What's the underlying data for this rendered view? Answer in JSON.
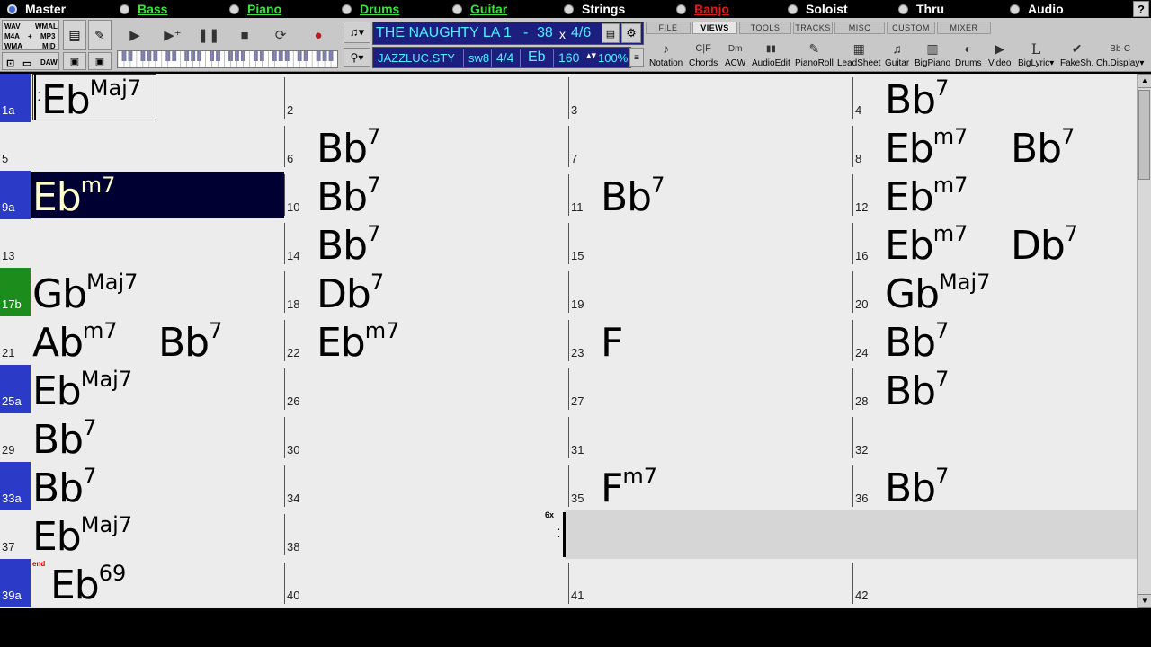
{
  "tracks": [
    {
      "label": "Master",
      "style": "white",
      "dot": "master"
    },
    {
      "label": "Bass",
      "style": "green"
    },
    {
      "label": "Piano",
      "style": "green"
    },
    {
      "label": "Drums",
      "style": "green"
    },
    {
      "label": "Guitar",
      "style": "green"
    },
    {
      "label": "Strings",
      "style": "white"
    },
    {
      "label": "Banjo",
      "style": "red"
    },
    {
      "label": "Soloist",
      "style": "white"
    },
    {
      "label": "Thru",
      "style": "white"
    },
    {
      "label": "Audio",
      "style": "white"
    }
  ],
  "help_label": "?",
  "formats": {
    "wav": "WAV",
    "wmal": "WMAL",
    "m4a": "M4A",
    "plus": "+",
    "mp3": "MP3",
    "wma": "WMA",
    "mid": "MID",
    "daw": "DAW"
  },
  "song": {
    "title": "THE NAUGHTY LA",
    "bar_from": "1",
    "dash": "-",
    "bar_to": "38",
    "times": "x",
    "choruses": "4/6",
    "style": "JAZZLUC.STY",
    "feel": "sw8",
    "time_sig": "4/4",
    "key": "Eb",
    "tempo": "160",
    "tempo_pct": "100%"
  },
  "view_tabs": [
    "FILE",
    "VIEWS",
    "TOOLS",
    "TRACKS",
    "MISC",
    "CUSTOM",
    "MIXER"
  ],
  "active_tab": "VIEWS",
  "view_items": [
    {
      "label": "Notation",
      "icon": "♪"
    },
    {
      "label": "Chords",
      "icon": "C|F"
    },
    {
      "label": "ACW",
      "icon": "Dm"
    },
    {
      "label": "AudioEdit",
      "icon": "▮▮"
    },
    {
      "label": "PianoRoll",
      "icon": "✎"
    },
    {
      "label": "LeadSheet",
      "icon": "▦"
    },
    {
      "label": "Guitar",
      "icon": "♫"
    },
    {
      "label": "BigPiano",
      "icon": "▥"
    },
    {
      "label": "Drums",
      "icon": "◐"
    },
    {
      "label": "Video",
      "icon": "▶"
    },
    {
      "label": "BigLyric▾",
      "icon": "L"
    },
    {
      "label": "FakeSh.",
      "icon": "✔"
    },
    {
      "label": "Ch.Display▾",
      "icon": "Bb·C"
    }
  ],
  "bars": [
    {
      "n": "1a",
      "marker": "blue",
      "chords": [
        {
          "r": "Eb",
          "e": "Maj7"
        }
      ],
      "repeat_start": true,
      "current": true
    },
    {
      "n": "2",
      "chords": []
    },
    {
      "n": "3",
      "chords": []
    },
    {
      "n": "4",
      "chords": [
        {
          "r": "Bb",
          "e": "7"
        }
      ]
    },
    {
      "n": "5",
      "chords": []
    },
    {
      "n": "6",
      "chords": [
        {
          "r": "Bb",
          "e": "7"
        }
      ]
    },
    {
      "n": "7",
      "chords": []
    },
    {
      "n": "8",
      "chords": [
        {
          "r": "Eb",
          "e": "m7"
        },
        {
          "r": "Bb",
          "e": "7"
        }
      ]
    },
    {
      "n": "9a",
      "marker": "blue",
      "chords": [
        {
          "r": "Eb",
          "e": "m7"
        }
      ],
      "highlight": true
    },
    {
      "n": "10",
      "chords": [
        {
          "r": "Bb",
          "e": "7"
        }
      ]
    },
    {
      "n": "11",
      "chords": [
        {
          "r": "Bb",
          "e": "7"
        }
      ]
    },
    {
      "n": "12",
      "chords": [
        {
          "r": "Eb",
          "e": "m7"
        }
      ]
    },
    {
      "n": "13",
      "chords": []
    },
    {
      "n": "14",
      "chords": [
        {
          "r": "Bb",
          "e": "7"
        }
      ]
    },
    {
      "n": "15",
      "chords": []
    },
    {
      "n": "16",
      "chords": [
        {
          "r": "Eb",
          "e": "m7"
        },
        {
          "r": "Db",
          "e": "7"
        }
      ]
    },
    {
      "n": "17b",
      "marker": "green",
      "chords": [
        {
          "r": "Gb",
          "e": "Maj7"
        }
      ]
    },
    {
      "n": "18",
      "chords": [
        {
          "r": "Db",
          "e": "7"
        }
      ]
    },
    {
      "n": "19",
      "chords": []
    },
    {
      "n": "20",
      "chords": [
        {
          "r": "Gb",
          "e": "Maj7"
        }
      ]
    },
    {
      "n": "21",
      "chords": [
        {
          "r": "Ab",
          "e": "m7"
        },
        {
          "r": "Bb",
          "e": "7"
        }
      ]
    },
    {
      "n": "22",
      "chords": [
        {
          "r": "Eb",
          "e": "m7"
        }
      ]
    },
    {
      "n": "23",
      "chords": [
        {
          "r": "F",
          "e": ""
        }
      ]
    },
    {
      "n": "24",
      "chords": [
        {
          "r": "Bb",
          "e": "7"
        }
      ]
    },
    {
      "n": "25a",
      "marker": "blue",
      "chords": [
        {
          "r": "Eb",
          "e": "Maj7"
        }
      ]
    },
    {
      "n": "26",
      "chords": []
    },
    {
      "n": "27",
      "chords": []
    },
    {
      "n": "28",
      "chords": [
        {
          "r": "Bb",
          "e": "7"
        }
      ]
    },
    {
      "n": "29",
      "chords": [
        {
          "r": "Bb",
          "e": "7"
        }
      ]
    },
    {
      "n": "30",
      "chords": []
    },
    {
      "n": "31",
      "chords": []
    },
    {
      "n": "32",
      "chords": []
    },
    {
      "n": "33a",
      "marker": "blue",
      "chords": [
        {
          "r": "Bb",
          "e": "7"
        }
      ]
    },
    {
      "n": "34",
      "chords": []
    },
    {
      "n": "35",
      "chords": [
        {
          "r": "F",
          "e": "m7"
        }
      ]
    },
    {
      "n": "36",
      "chords": [
        {
          "r": "Bb",
          "e": "7"
        }
      ]
    },
    {
      "n": "37",
      "chords": [
        {
          "r": "Eb",
          "e": "Maj7"
        }
      ]
    },
    {
      "n": "38",
      "chords": [],
      "repeat_end": true,
      "repeat_label": "6x"
    },
    {
      "n": "",
      "chords": [],
      "greyed": true
    },
    {
      "n": "",
      "chords": [],
      "greyed": true
    },
    {
      "n": "39a",
      "marker": "blue",
      "chords": [
        {
          "r": "Eb",
          "e": "69"
        }
      ],
      "end_label": "end"
    },
    {
      "n": "40",
      "chords": []
    },
    {
      "n": "41",
      "chords": []
    },
    {
      "n": "42",
      "chords": []
    }
  ],
  "colors": {
    "accent_blue": "#2c3ac8",
    "accent_green": "#1c8c1c",
    "highlight": "#000033",
    "title_bg": "#1d1f7e",
    "title_text": "#4ff0ff"
  }
}
